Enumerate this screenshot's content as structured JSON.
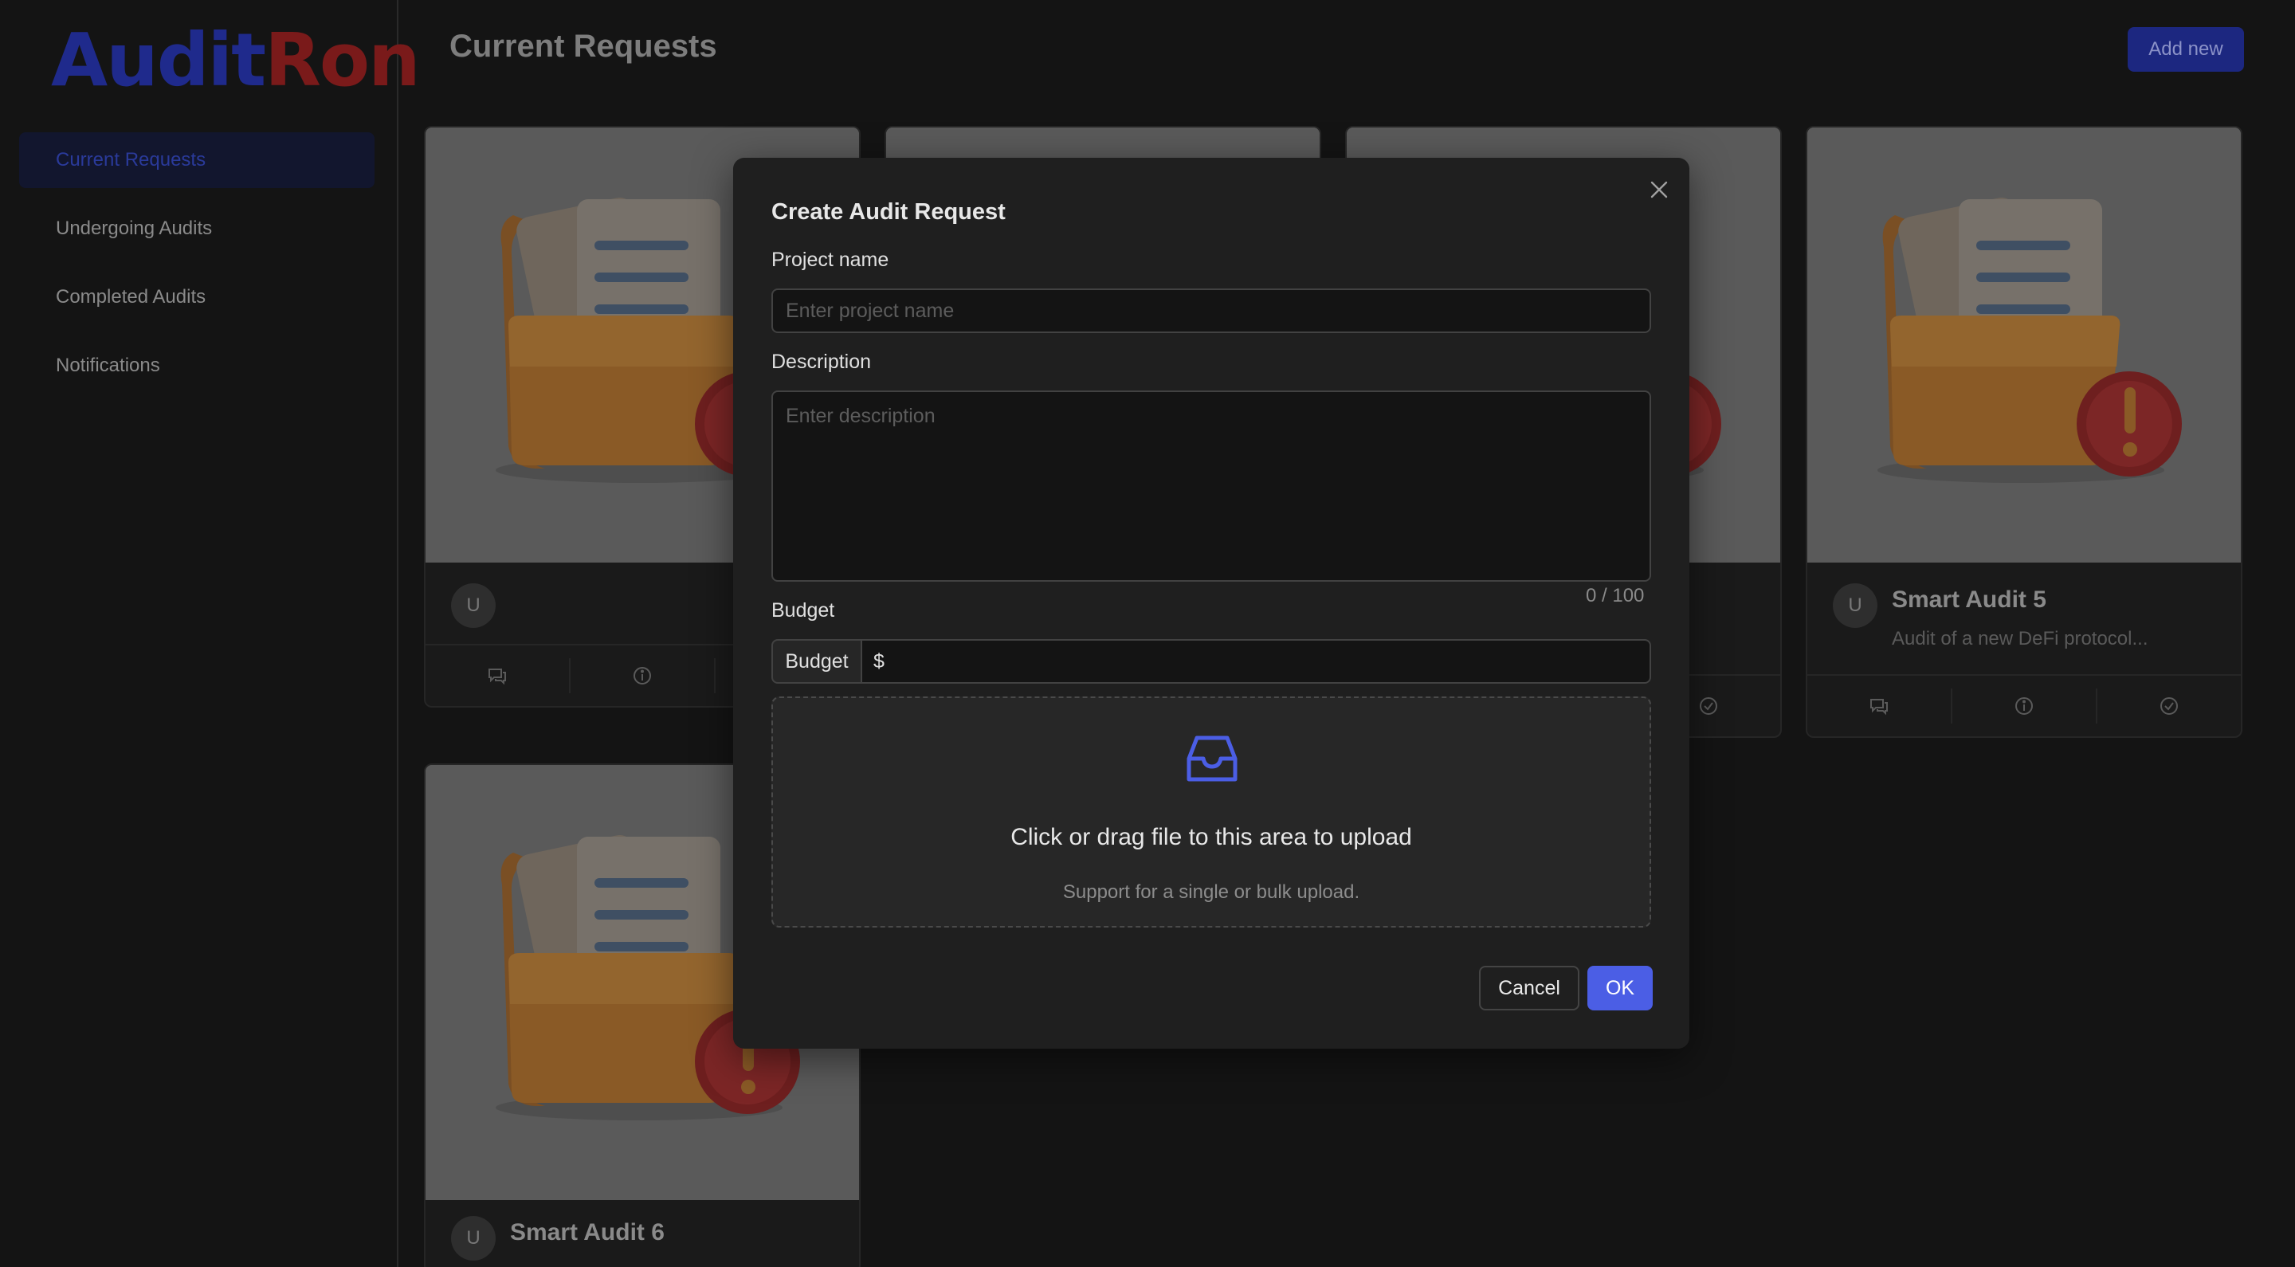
{
  "app": {
    "logo_part1": "Audit",
    "logo_part2": "Ron"
  },
  "colors": {
    "accent": "#4b5ee5",
    "logo_blue": "#1f2a8c",
    "logo_red": "#7a1a1a",
    "background": "#141414",
    "modal": "#1f1f1f"
  },
  "sidebar": {
    "items": [
      {
        "label": "Current Requests",
        "active": true
      },
      {
        "label": "Undergoing Audits",
        "active": false
      },
      {
        "label": "Completed Audits",
        "active": false
      },
      {
        "label": "Notifications",
        "active": false
      }
    ]
  },
  "header": {
    "title": "Current Requests",
    "add_button": "Add new"
  },
  "cards": [
    {
      "avatar": "U",
      "title": "",
      "description": "",
      "icons": [
        "comment-icon",
        "info-icon",
        "check-circle-icon"
      ]
    },
    {
      "avatar": "U",
      "title": "",
      "description": "",
      "icons": [
        "comment-icon",
        "info-icon",
        "check-circle-icon"
      ]
    },
    {
      "avatar": "U",
      "title": "",
      "description": "",
      "icons": [
        "comment-icon",
        "info-icon",
        "check-circle-icon"
      ]
    },
    {
      "avatar": "U",
      "title": "Smart Audit 5",
      "description": "Audit of a new DeFi protocol...",
      "icons": [
        "comment-icon",
        "info-icon",
        "check-circle-icon"
      ]
    },
    {
      "avatar": "U",
      "title": "Smart Audit 6",
      "description": "",
      "icons": []
    }
  ],
  "modal": {
    "title": "Create Audit Request",
    "project_name_label": "Project name",
    "project_name_placeholder": "Enter project name",
    "description_label": "Description",
    "description_placeholder": "Enter description",
    "char_counter": "0 / 100",
    "budget_label": "Budget",
    "budget_addon": "Budget",
    "budget_prefix": "$",
    "upload_text": "Click or drag file to this area to upload",
    "upload_hint": "Support for a single or bulk upload.",
    "upload_icon": "inbox-icon",
    "cancel_label": "Cancel",
    "ok_label": "OK"
  }
}
